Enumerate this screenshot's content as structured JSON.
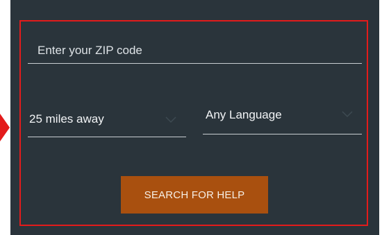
{
  "form": {
    "zip": {
      "placeholder": "Enter your ZIP code",
      "value": ""
    },
    "distance": {
      "selected": "25 miles away",
      "icon": "chevron-down-icon"
    },
    "language": {
      "selected": "Any Language",
      "icon": "chevron-down-icon"
    },
    "search_label": "SEARCH FOR HELP"
  },
  "colors": {
    "panel_background": "#2a343b",
    "highlight_border": "#e31b1b",
    "button_background": "#a9500f",
    "underline": "#c9ced2"
  }
}
